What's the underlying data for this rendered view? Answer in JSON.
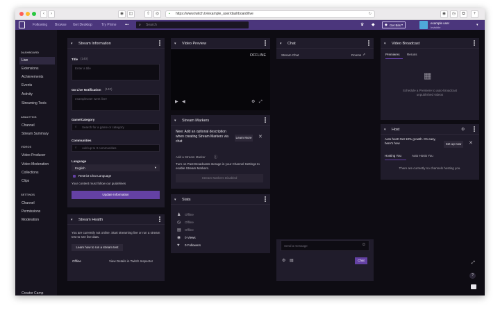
{
  "browser": {
    "url": "https://www.twitch.tv/example_user/dashboard/live",
    "back_glyph": "‹",
    "forward_glyph": "›"
  },
  "topnav": {
    "links": [
      "Following",
      "Browse",
      "Get Desktop",
      "Try Prime"
    ],
    "more": "•••",
    "search_placeholder": "Search",
    "get_bits": "Get Bits",
    "username": "example user",
    "user_status": "Invisible"
  },
  "sidebar": {
    "sections": [
      {
        "header": "DASHBOARD",
        "items": [
          "Live",
          "Extensions",
          "Achievements",
          "Events",
          "Activity",
          "Streaming Tools"
        ]
      },
      {
        "header": "ANALYTICS",
        "items": [
          "Channel",
          "Stream Summary"
        ]
      },
      {
        "header": "VIDEOS",
        "items": [
          "Video Producer",
          "Video Moderation",
          "Collections",
          "Clips"
        ]
      },
      {
        "header": "SETTINGS",
        "items": [
          "Channel",
          "Permissions",
          "Moderation"
        ]
      }
    ],
    "footer": "Creator Camp"
  },
  "stream_info": {
    "title": "Stream Information",
    "title_label": "Title",
    "title_count": "(140)",
    "title_placeholder": "Enter a title",
    "notif_label": "Go Live Notification",
    "notif_count": "(140)",
    "notif_placeholder": "exampleuser went live!",
    "game_label": "Game/Category",
    "game_placeholder": "Search for a game or category",
    "communities_label": "Communities",
    "communities_placeholder": "Add up to 3 communities",
    "language_label": "Language",
    "language_value": "English",
    "restrict_chat": "Restrict Chat Language",
    "guidelines_note": "Your content must follow our guidelines",
    "update_button": "Update Information"
  },
  "stream_health": {
    "title": "Stream Health",
    "message": "You are currently not online. Start streaming live or run a stream test to see live data.",
    "learn_button": "Learn how to run a stream test",
    "status": "Offline",
    "inspector_link": "View Details in Twitch Inspector"
  },
  "video_preview": {
    "title": "Video Preview",
    "status": "OFFLINE"
  },
  "stream_markers": {
    "title": "Stream Markers",
    "new_text": "New: Add an optional description when creating Stream Markers via chat",
    "learn_more": "Learn More",
    "add_label": "Add a Stream Marker",
    "info_text": "Turn on Past Broadcasts storage in your Channel Settings to enable Stream Markers.",
    "disabled_button": "Stream Markers Disabled"
  },
  "stats": {
    "title": "Stats",
    "rows": [
      {
        "icon": "viewers-icon",
        "value": "Offline"
      },
      {
        "icon": "uptime-icon",
        "value": "Offline"
      },
      {
        "icon": "bitrate-icon",
        "value": "Offline"
      },
      {
        "icon": "views-icon",
        "value": "0 Views"
      },
      {
        "icon": "followers-icon",
        "value": "0 Followers"
      }
    ]
  },
  "chat": {
    "title": "Chat",
    "stream_chat": "Stream Chat",
    "rooms": "Rooms",
    "send_placeholder": "Send a message",
    "chat_button": "Chat"
  },
  "video_broadcast": {
    "title": "Video Broadcast",
    "tabs": [
      "Premieres",
      "Reruns"
    ],
    "message": "Schedule a Premiere to auto-broadcast unpublished videos"
  },
  "host": {
    "title": "Host",
    "promo": "Auto host! Get 10% growth. It's easy, here's how",
    "setup_button": "Set up now",
    "tabs": [
      "Hosting You",
      "Auto Hosts You"
    ],
    "empty": "There are currently no channels hosting you."
  },
  "colors": {
    "accent": "#6441a4",
    "topnav": "#4b367c",
    "panel": "#201c2b",
    "background": "#0e0c13"
  }
}
